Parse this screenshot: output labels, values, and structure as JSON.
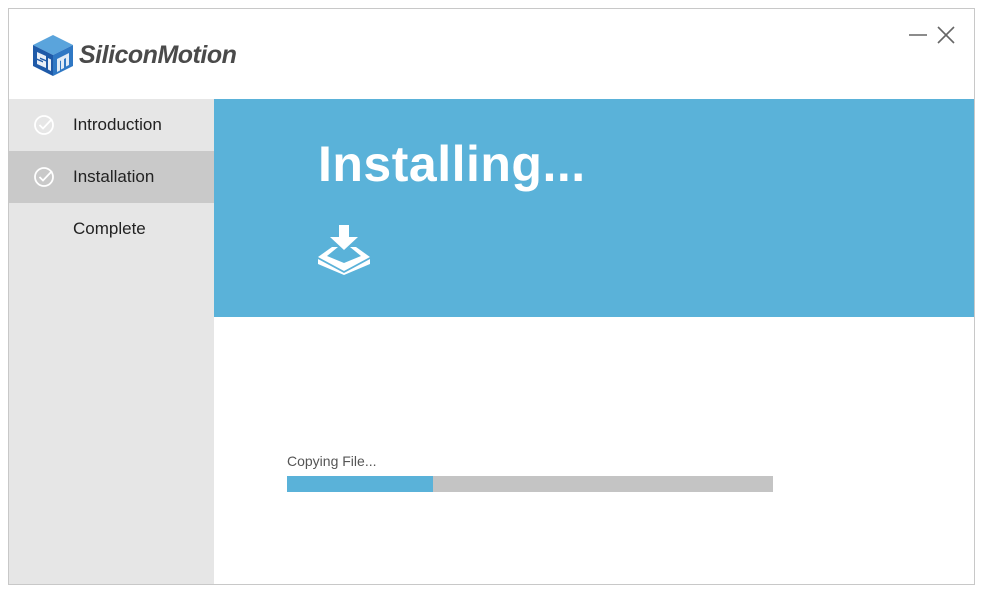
{
  "app": {
    "brand": "SiliconMotion",
    "logo_icon": "silicon-motion-cube-logo"
  },
  "window_controls": {
    "minimize_icon": "minimize-icon",
    "close_icon": "close-icon"
  },
  "sidebar": {
    "items": [
      {
        "label": "Introduction",
        "checked": true,
        "active": false
      },
      {
        "label": "Installation",
        "checked": true,
        "active": true
      },
      {
        "label": "Complete",
        "checked": false,
        "active": false
      }
    ]
  },
  "banner": {
    "title": "Installing...",
    "icon": "download-tray-icon"
  },
  "progress": {
    "status": "Copying File...",
    "value_percent": 30
  },
  "colors": {
    "accent": "#5ab2d9",
    "sidebar_bg": "#e6e6e6",
    "sidebar_active": "#c9c9c9",
    "track": "#c4c4c4"
  }
}
